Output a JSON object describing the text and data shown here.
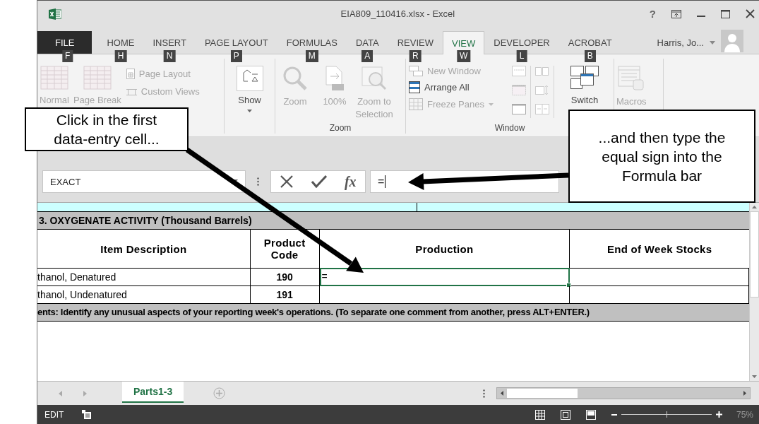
{
  "window": {
    "title": "EIA809_110416.xlsx - Excel",
    "help": "?"
  },
  "ribbon_tabs": [
    {
      "label": "FILE",
      "keytip": "F",
      "kind": "file",
      "selected": false
    },
    {
      "label": "HOME",
      "keytip": "H",
      "kind": "tab",
      "selected": false
    },
    {
      "label": "INSERT",
      "keytip": "N",
      "kind": "tab",
      "selected": false
    },
    {
      "label": "PAGE LAYOUT",
      "keytip": "P",
      "kind": "tab",
      "selected": false
    },
    {
      "label": "FORMULAS",
      "keytip": "M",
      "kind": "tab",
      "selected": false
    },
    {
      "label": "DATA",
      "keytip": "A",
      "kind": "tab",
      "selected": false
    },
    {
      "label": "REVIEW",
      "keytip": "R",
      "kind": "tab",
      "selected": false
    },
    {
      "label": "VIEW",
      "keytip": "W",
      "kind": "tab",
      "selected": true
    },
    {
      "label": "DEVELOPER",
      "keytip": "L",
      "kind": "tab",
      "selected": false
    },
    {
      "label": "ACROBAT",
      "keytip": "B",
      "kind": "tab",
      "selected": false
    }
  ],
  "account": {
    "name": "Harris, Jo..."
  },
  "ribbon": {
    "normal": {
      "label": "Normal",
      "disabled": true
    },
    "page_break": {
      "label": "Page Break",
      "disabled": true
    },
    "page_layout": {
      "label": "Page Layout",
      "disabled": true
    },
    "custom_views": {
      "label": "Custom Views",
      "disabled": true
    },
    "show": {
      "label": "Show",
      "disabled": false
    },
    "zoom_group": {
      "label": "Zoom",
      "items": [
        {
          "label": "Zoom",
          "disabled": true
        },
        {
          "label": "100%",
          "disabled": true
        },
        {
          "label": "Zoom to Selection",
          "disabled": true
        }
      ]
    },
    "window_group": {
      "label": "Window",
      "new_window": {
        "label": "New Window",
        "disabled": true
      },
      "arrange_all": {
        "label": "Arrange All",
        "disabled": false
      },
      "freeze_panes": {
        "label": "Freeze Panes",
        "disabled": true
      },
      "switch_windows": {
        "label": "Switch",
        "disabled": false
      }
    },
    "macros": {
      "label": "Macros",
      "disabled": true
    }
  },
  "formula_bar": {
    "name_box": "EXACT",
    "function_button": "fx",
    "value": "="
  },
  "sheet": {
    "section_title": "3.  OXYGENATE ACTIVITY (Thousand Barrels)",
    "columns": [
      "Item Description",
      "Product Code",
      "Production",
      "End of Week Stocks"
    ],
    "rows": [
      {
        "description": "thanol, Denatured",
        "code": "190",
        "production": "=",
        "selected": true
      },
      {
        "description": "thanol, Undenatured",
        "code": "191",
        "selected": false
      }
    ],
    "comment_prompt": "ents: Identify any unusual aspects of your reporting week's operations. (To separate one comment from another, press ALT+ENTER.)"
  },
  "sheet_tabs": [
    {
      "label": "Parts1-3",
      "selected": true
    }
  ],
  "status_bar": {
    "mode": "EDIT",
    "zoom": {
      "level": 0.5,
      "reading": "75%"
    }
  },
  "callouts": [
    {
      "text": "Click in the first data-entry cell..."
    },
    {
      "text": "...and then type the equal sign into the Formula bar"
    }
  ]
}
